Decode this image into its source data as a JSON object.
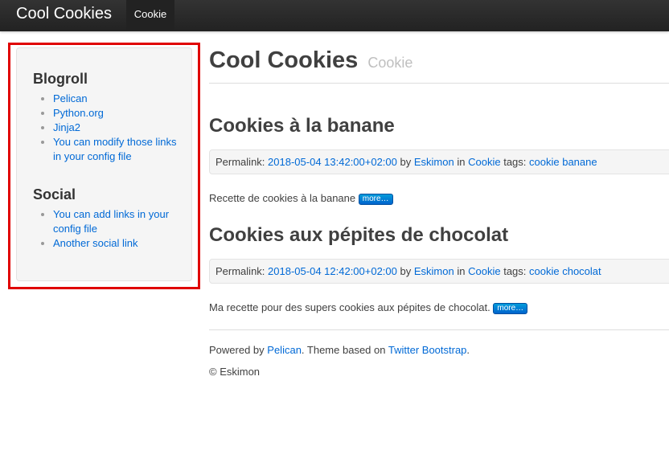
{
  "navbar": {
    "brand": "Cool Cookies",
    "items": [
      {
        "label": "Cookie",
        "active": true
      }
    ]
  },
  "sidebar": {
    "blogroll": {
      "heading": "Blogroll",
      "links": [
        "Pelican",
        "Python.org",
        "Jinja2",
        "You can modify those links in your config file"
      ]
    },
    "social": {
      "heading": "Social",
      "links": [
        "You can add links in your config file",
        "Another social link"
      ]
    }
  },
  "main": {
    "title": "Cool Cookies",
    "subtitle": "Cookie",
    "posts": [
      {
        "title": "Cookies à la banane",
        "permalink_label": "Permalink:",
        "date": "2018-05-04 13:42:00+02:00",
        "by": "by",
        "author": "Eskimon",
        "in": "in",
        "category": "Cookie",
        "tags_label": "tags:",
        "tags": [
          "cookie",
          "banane"
        ],
        "summary": "Recette de cookies à la banane",
        "more": "more…"
      },
      {
        "title": "Cookies aux pépites de chocolat",
        "permalink_label": "Permalink:",
        "date": "2018-05-04 12:42:00+02:00",
        "by": "by",
        "author": "Eskimon",
        "in": "in",
        "category": "Cookie",
        "tags_label": "tags:",
        "tags": [
          "cookie",
          "chocolat"
        ],
        "summary": "Ma recette pour des supers cookies aux pépites de chocolat.",
        "more": "more…"
      }
    ]
  },
  "footer": {
    "powered_by": "Powered by",
    "pelican_link": "Pelican",
    "theme_text": ". Theme based on",
    "bootstrap_link": "Twitter Bootstrap",
    "period": ".",
    "copyright": "© Eskimon"
  },
  "colors": {
    "link": "#0069d6",
    "highlight": "#e00000",
    "navbar": "#222222"
  }
}
